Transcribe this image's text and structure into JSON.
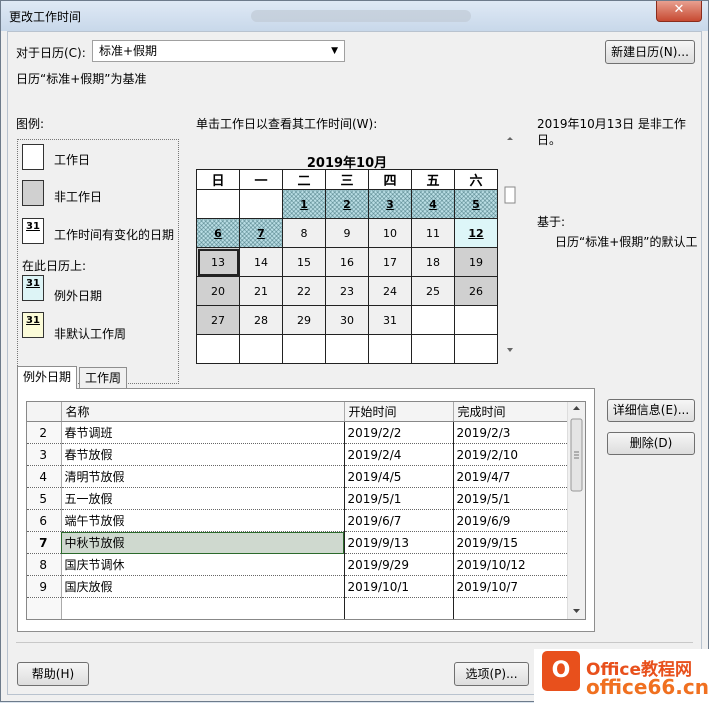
{
  "window": {
    "title": "更改工作时间",
    "close_glyph": "✕"
  },
  "top": {
    "calendar_label": "对于日历(C):",
    "calendar_value": "标准+假期",
    "new_calendar_button": "新建日历(N)...",
    "base_info": "日历“标准+假期”为基准"
  },
  "legend": {
    "heading": "图例:",
    "items": [
      {
        "label": "工作日",
        "swatch": ""
      },
      {
        "label": "非工作日",
        "swatch": ""
      },
      {
        "label": "工作时间有变化的日期",
        "swatch": "31"
      }
    ],
    "on_this_calendar": "在此日历上:",
    "items2": [
      {
        "label": "例外日期",
        "swatch": "31"
      },
      {
        "label": "非默认工作周",
        "swatch": "31"
      }
    ]
  },
  "calendar": {
    "instruction": "单击工作日以查看其工作时间(W):",
    "month_title": "2019年10月",
    "weekdays": [
      "日",
      "一",
      "二",
      "三",
      "四",
      "五",
      "六"
    ],
    "weeks": [
      [
        "",
        "",
        "1",
        "2",
        "3",
        "4",
        "5"
      ],
      [
        "6",
        "7",
        "8",
        "9",
        "10",
        "11",
        "12"
      ],
      [
        "13",
        "14",
        "15",
        "16",
        "17",
        "18",
        "19"
      ],
      [
        "20",
        "21",
        "22",
        "23",
        "24",
        "25",
        "26"
      ],
      [
        "27",
        "28",
        "29",
        "30",
        "31",
        "",
        ""
      ],
      [
        "",
        "",
        "",
        "",
        "",
        "",
        ""
      ]
    ],
    "colors": {
      "exception": "#b9dde4",
      "changed": "#ddf6f8",
      "nonworking": "#d0d0d0"
    }
  },
  "info": {
    "date_status": "2019年10月13日 是非工作日。",
    "based_on_label": "基于:",
    "based_on_value": "日历“标准+假期”的默认工"
  },
  "tabs": [
    {
      "label": "例外日期",
      "active": true
    },
    {
      "label": "工作周",
      "active": false
    }
  ],
  "exceptions_table": {
    "columns": [
      "",
      "名称",
      "开始时间",
      "完成时间"
    ],
    "rows": [
      {
        "n": "2",
        "name": "春节调班",
        "start": "2019/2/2",
        "end": "2019/2/3",
        "selected": false
      },
      {
        "n": "3",
        "name": "春节放假",
        "start": "2019/2/4",
        "end": "2019/2/10",
        "selected": false
      },
      {
        "n": "4",
        "name": "清明节放假",
        "start": "2019/4/5",
        "end": "2019/4/7",
        "selected": false
      },
      {
        "n": "5",
        "name": "五一放假",
        "start": "2019/5/1",
        "end": "2019/5/1",
        "selected": false
      },
      {
        "n": "6",
        "name": "端午节放假",
        "start": "2019/6/7",
        "end": "2019/6/9",
        "selected": false
      },
      {
        "n": "7",
        "name": "中秋节放假",
        "start": "2019/9/13",
        "end": "2019/9/15",
        "selected": true
      },
      {
        "n": "8",
        "name": "国庆节调休",
        "start": "2019/9/29",
        "end": "2019/10/12",
        "selected": false
      },
      {
        "n": "9",
        "name": "国庆放假",
        "start": "2019/10/1",
        "end": "2019/10/7",
        "selected": false
      },
      {
        "n": "",
        "name": "",
        "start": "",
        "end": "",
        "selected": false
      },
      {
        "n": "",
        "name": "",
        "start": "",
        "end": "",
        "selected": false
      }
    ]
  },
  "side_buttons": {
    "details": "详细信息(E)...",
    "delete": "删除(D)"
  },
  "bottom": {
    "help": "帮助(H)",
    "options": "选项(P)..."
  },
  "watermark": {
    "logo_glyph": "O",
    "line1": "Office教程网",
    "line2": "office66.cn"
  }
}
